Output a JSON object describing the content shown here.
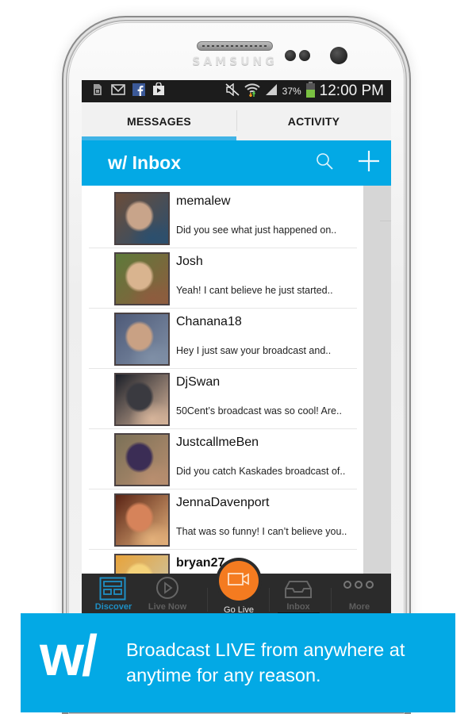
{
  "device": {
    "brand": "SAMSUNG"
  },
  "status_bar": {
    "left_icons": [
      "sd-card-icon",
      "gmail-icon",
      "facebook-icon",
      "play-store-icon"
    ],
    "right_icons": [
      "mute-icon",
      "wifi-icon",
      "signal-icon"
    ],
    "battery_percent": "37%",
    "time": "12:00 PM",
    "colors": {
      "battery": "#7ac142",
      "wifi_up": "#58c447",
      "wifi_down": "#f39a1e"
    }
  },
  "tabs": [
    {
      "label": "MESSAGES",
      "active": true
    },
    {
      "label": "ACTIVITY",
      "active": false
    }
  ],
  "app_bar": {
    "title": "w/ Inbox",
    "actions": [
      "search-icon",
      "plus-icon"
    ]
  },
  "messages": [
    {
      "name": "memalew",
      "preview": "Did you see what just happened on..",
      "avatar_colors": [
        "#6b4d3a",
        "#c8a48a",
        "#2b4f6e"
      ]
    },
    {
      "name": "Josh",
      "preview": "Yeah! I cant believe he just started..",
      "avatar_colors": [
        "#5d7a3a",
        "#d9b48f",
        "#8e5c3e"
      ]
    },
    {
      "name": "Chanana18",
      "preview": "Hey I just saw your broadcast and..",
      "avatar_colors": [
        "#4e5a78",
        "#c9a184",
        "#7f8fa6"
      ]
    },
    {
      "name": "DjSwan",
      "preview": "50Cent’s broadcast was so cool! Are..",
      "avatar_colors": [
        "#1b1f28",
        "#3a3a40",
        "#d6b49a"
      ]
    },
    {
      "name": "JustcallmeBen",
      "preview": "Did you catch Kaskades broadcast of..",
      "avatar_colors": [
        "#7a7057",
        "#3b2d55",
        "#b88e6f"
      ]
    },
    {
      "name": "JennaDavenport",
      "preview": "That was so funny! I can’t believe you..",
      "avatar_colors": [
        "#5a2415",
        "#d6835a",
        "#e3b07a"
      ]
    },
    {
      "name": "bryan27",
      "preview": "",
      "avatar_colors": [
        "#e8a33a",
        "#f4d27a",
        "#c9c9b0"
      ]
    }
  ],
  "bottom_nav": {
    "items": [
      {
        "label": "Discover",
        "icon": "discover-icon",
        "active": true
      },
      {
        "label": "Live Now",
        "icon": "play-circle-icon",
        "active": false
      },
      {
        "label": "Go Live",
        "icon": "video-camera-icon",
        "active": false
      },
      {
        "label": "Inbox",
        "icon": "inbox-tray-icon",
        "active": false
      },
      {
        "label": "More",
        "icon": "more-dots-icon",
        "active": false
      }
    ],
    "colors": {
      "active": "#1e8fc4",
      "go_live": "#f47b20"
    }
  },
  "banner": {
    "logo": "w/",
    "text": "Broadcast LIVE from anywhere at anytime for any reason.",
    "color": "#03a9e5"
  }
}
